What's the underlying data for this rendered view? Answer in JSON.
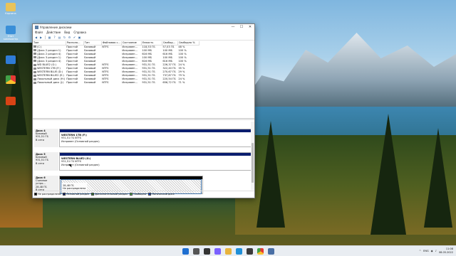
{
  "window": {
    "title": "Управление дисками",
    "controls": {
      "minimize": "—",
      "maximize": "☐",
      "close": "✕"
    }
  },
  "menu": [
    "Файл",
    "Действие",
    "Вид",
    "Справка"
  ],
  "toolbar_icons": [
    "back-icon",
    "forward-icon",
    "grid-icon",
    "help-icon",
    "properties-icon",
    "refresh-icon",
    "settings-icon",
    "check-icon",
    "view-icon"
  ],
  "volumes": {
    "headers": [
      "Том",
      "Располо...",
      "Тип",
      "Файловая с...",
      "Состояние",
      "Емкость",
      "Свобод...",
      "Свободно %"
    ],
    "rows": [
      [
        "(C:)",
        "Простой",
        "Базовый",
        "NTFS",
        "Исправен...",
        "118,53 ГБ",
        "57,03 ГБ",
        "48 %"
      ],
      [
        "(Диск 2 раздел 1)",
        "Простой",
        "Базовый",
        "",
        "Исправен...",
        "100 МБ",
        "100 МБ",
        "100 %"
      ],
      [
        "(Диск 2 раздел 4)",
        "Простой",
        "Базовый",
        "",
        "Исправен...",
        "616 МБ",
        "616 МБ",
        "100 %"
      ],
      [
        "(Диск 3 раздел 1)",
        "Простой",
        "Базовый",
        "",
        "Исправен...",
        "100 МБ",
        "100 МБ",
        "100 %"
      ],
      [
        "(Диск 3 раздел 4)",
        "Простой",
        "Базовый",
        "",
        "Исправен...",
        "616 МБ",
        "616 МБ",
        "100 %"
      ],
      [
        "WD BLUE2 (G:)",
        "Простой",
        "Базовый",
        "NTFS",
        "Исправен...",
        "931,51 ГБ",
        "226,37 ГБ",
        "24 %"
      ],
      [
        "WESTERN 1TB (F:)",
        "Простой",
        "Базовый",
        "NTFS",
        "Исправен...",
        "931,51 ГБ",
        "322,40 ГБ",
        "35 %"
      ],
      [
        "WESTERN BLUE (D:)",
        "Простой",
        "Базовый",
        "NTFS",
        "Исправен...",
        "931,51 ГБ",
        "270,67 ГБ",
        "29 %"
      ],
      [
        "WESTERN BLUE2 (E:)",
        "Простой",
        "Базовый",
        "NTFS",
        "Исправен...",
        "931,51 ГБ",
        "737,87 ГБ",
        "79 %"
      ],
      [
        "Локальный диск (H:)",
        "Простой",
        "Базовый",
        "NTFS",
        "Исправен...",
        "931,51 ГБ",
        "220,54 ГБ",
        "24 %"
      ],
      [
        "Локальный диск (J:)",
        "Простой",
        "Базовый",
        "NTFS",
        "Исправен...",
        "931,51 ГБ",
        "656,72 ГБ",
        "71 %"
      ]
    ]
  },
  "disks": [
    {
      "name": "Диск 4",
      "type": "Базовый",
      "size": "931,51 ГБ",
      "status": "В сети",
      "partition": {
        "name": "WESTERN 1TB (F:)",
        "size": "931,51 ГБ NTFS",
        "state": "Исправен (Основной раздел)"
      }
    },
    {
      "name": "Диск 5",
      "type": "Базовый",
      "size": "931,51 ГБ",
      "status": "В сети",
      "partition": {
        "name": "WESTERN BLUE2 (G:)",
        "size": "931,51 ГБ NTFS",
        "state": "Исправен (Основной раздел)"
      }
    },
    {
      "name": "Диск 6",
      "type": "Съемное устро...",
      "size": "28,48 ГБ",
      "status": "В сети",
      "partition": {
        "size": "28,48 ГБ",
        "state": "Не распределена"
      }
    }
  ],
  "legend": [
    {
      "label": "Не распределена",
      "color": "#000000"
    },
    {
      "label": "Основной раздел",
      "color": "#0a1d6e"
    },
    {
      "label": "Дополнительный раздел",
      "color": "#2e7d32"
    },
    {
      "label": "Свободно",
      "color": "#4caf50"
    },
    {
      "label": "Логический диск",
      "color": "#1a47c8"
    }
  ],
  "desktop_icons": [
    "Корзина",
    "Этот компьютер"
  ],
  "tray": {
    "lang": "ENG",
    "time": "11:08",
    "date": "08.05.2022"
  },
  "colors": {
    "primary_partition": "#0a1d6e",
    "unallocated": "#000000"
  }
}
